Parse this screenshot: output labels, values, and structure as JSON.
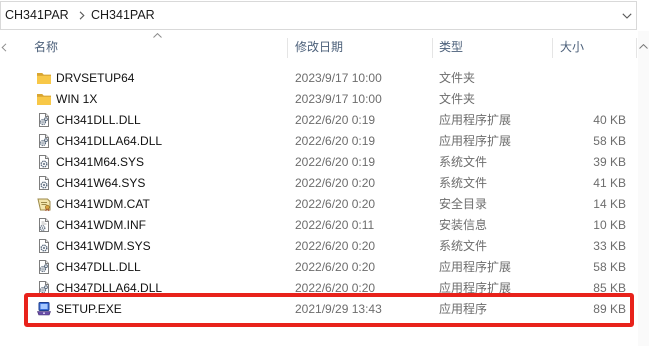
{
  "address_bar": {
    "crumbs": [
      "CH341PAR",
      "CH341PAR"
    ],
    "separator_icon": "chevron-right-icon",
    "dropdown_icon": "chevron-down-icon"
  },
  "columns": {
    "name": "名称",
    "modified": "修改日期",
    "type": "类型",
    "size": "大小",
    "sort_icon": "sort-up-icon"
  },
  "files": [
    {
      "name": "DRVSETUP64",
      "modified": "2023/9/17 10:00",
      "type": "文件夹",
      "size": "",
      "icon": "folder-icon"
    },
    {
      "name": "WIN 1X",
      "modified": "2023/9/17 10:00",
      "type": "文件夹",
      "size": "",
      "icon": "folder-icon"
    },
    {
      "name": "CH341DLL.DLL",
      "modified": "2022/6/20 0:19",
      "type": "应用程序扩展",
      "size": "40 KB",
      "icon": "dll-file-icon"
    },
    {
      "name": "CH341DLLA64.DLL",
      "modified": "2022/6/20 0:19",
      "type": "应用程序扩展",
      "size": "58 KB",
      "icon": "dll-file-icon"
    },
    {
      "name": "CH341M64.SYS",
      "modified": "2022/6/20 0:19",
      "type": "系统文件",
      "size": "39 KB",
      "icon": "sys-file-icon"
    },
    {
      "name": "CH341W64.SYS",
      "modified": "2022/6/20 0:20",
      "type": "系统文件",
      "size": "41 KB",
      "icon": "sys-file-icon"
    },
    {
      "name": "CH341WDM.CAT",
      "modified": "2022/6/20 0:20",
      "type": "安全目录",
      "size": "14 KB",
      "icon": "catalog-file-icon"
    },
    {
      "name": "CH341WDM.INF",
      "modified": "2022/6/20 0:11",
      "type": "安装信息",
      "size": "10 KB",
      "icon": "inf-file-icon"
    },
    {
      "name": "CH341WDM.SYS",
      "modified": "2022/6/20 0:20",
      "type": "系统文件",
      "size": "33 KB",
      "icon": "sys-file-icon"
    },
    {
      "name": "CH347DLL.DLL",
      "modified": "2022/6/20 0:20",
      "type": "应用程序扩展",
      "size": "58 KB",
      "icon": "dll-file-icon"
    },
    {
      "name": "CH347DLLA64.DLL",
      "modified": "2022/6/20 0:20",
      "type": "应用程序扩展",
      "size": "85 KB",
      "icon": "dll-file-icon"
    },
    {
      "name": "SETUP.EXE",
      "modified": "2021/9/29 13:43",
      "type": "应用程序",
      "size": "89 KB",
      "icon": "setup-exe-icon",
      "highlighted": true
    }
  ],
  "colors": {
    "highlight_border": "#e8221b",
    "secondary_text": "#6d6d6d",
    "header_text": "#4c607a",
    "folder": "#f8c848"
  }
}
